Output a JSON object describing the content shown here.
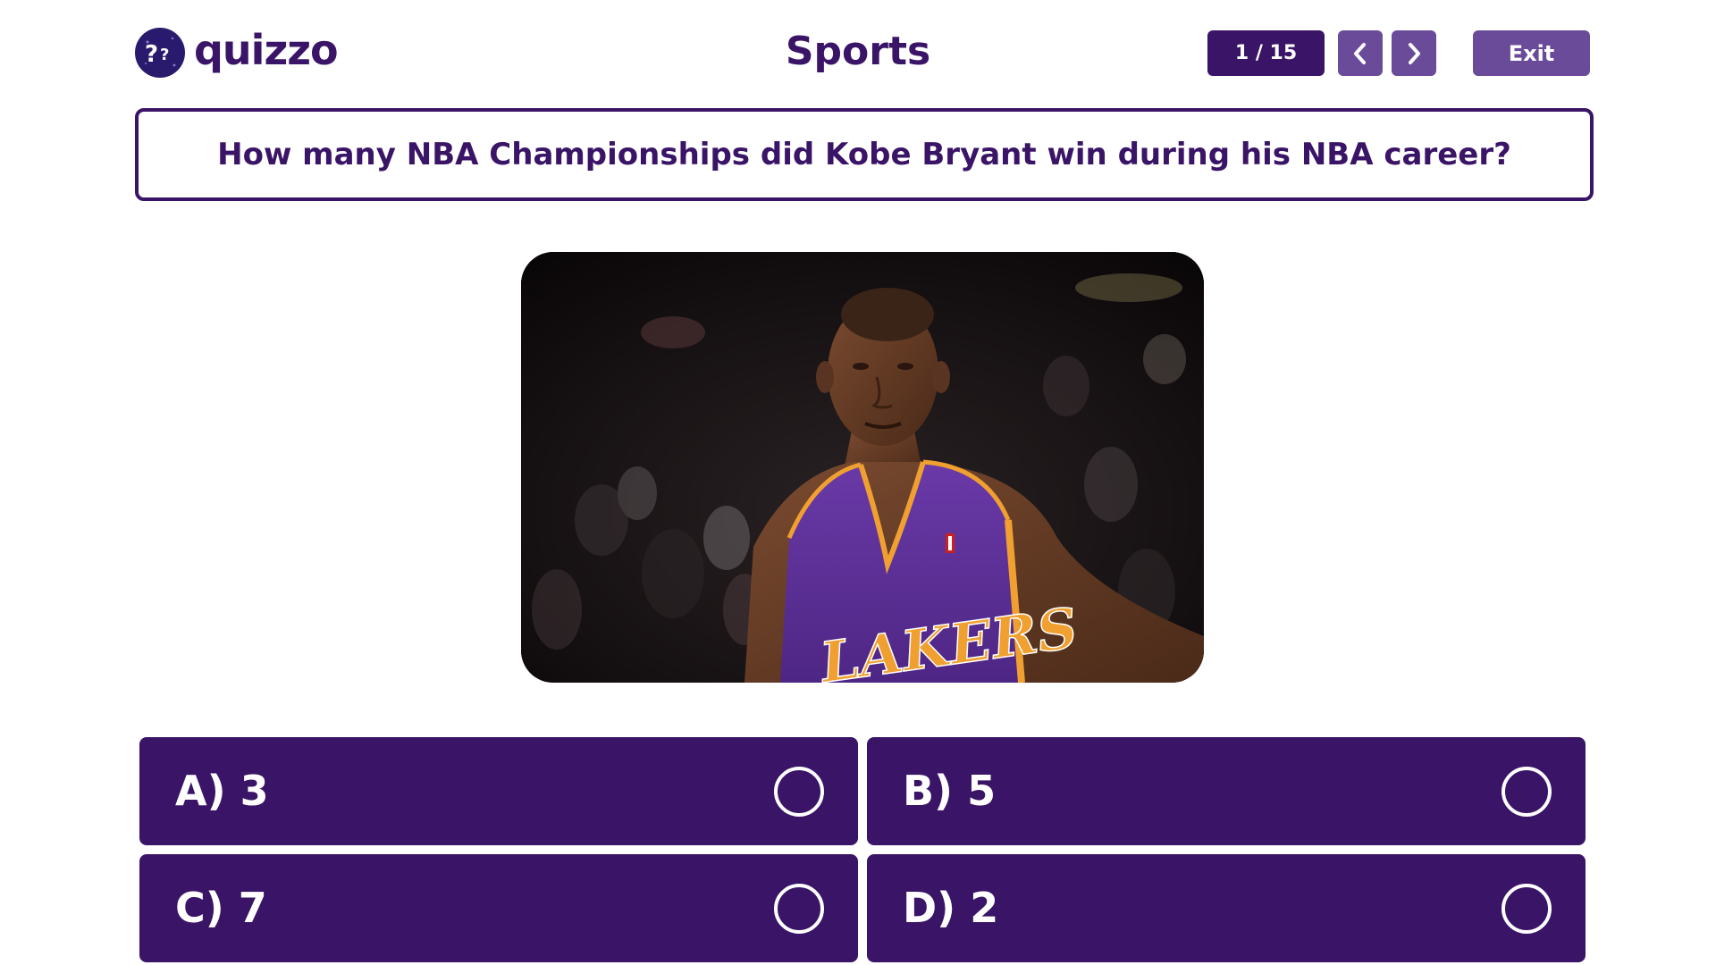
{
  "app": {
    "name": "quizzo",
    "logo_icon": "question-marks-logo-icon"
  },
  "header": {
    "category": "Sports",
    "counter": "1 / 15",
    "prev_icon": "chevron-left-icon",
    "next_icon": "chevron-right-icon",
    "exit_label": "Exit"
  },
  "question": {
    "text": "How many NBA Championships did Kobe Bryant win during his NBA career?",
    "image_subject": "basketball player in purple Lakers jersey"
  },
  "answers": [
    {
      "label": "A)  3",
      "selected": false
    },
    {
      "label": "B)  5",
      "selected": false
    },
    {
      "label": "C)  7",
      "selected": false
    },
    {
      "label": "D)  2",
      "selected": false
    }
  ],
  "colors": {
    "primary": "#3a1466",
    "secondary": "#6a4b9a",
    "background": "#ffffff"
  }
}
